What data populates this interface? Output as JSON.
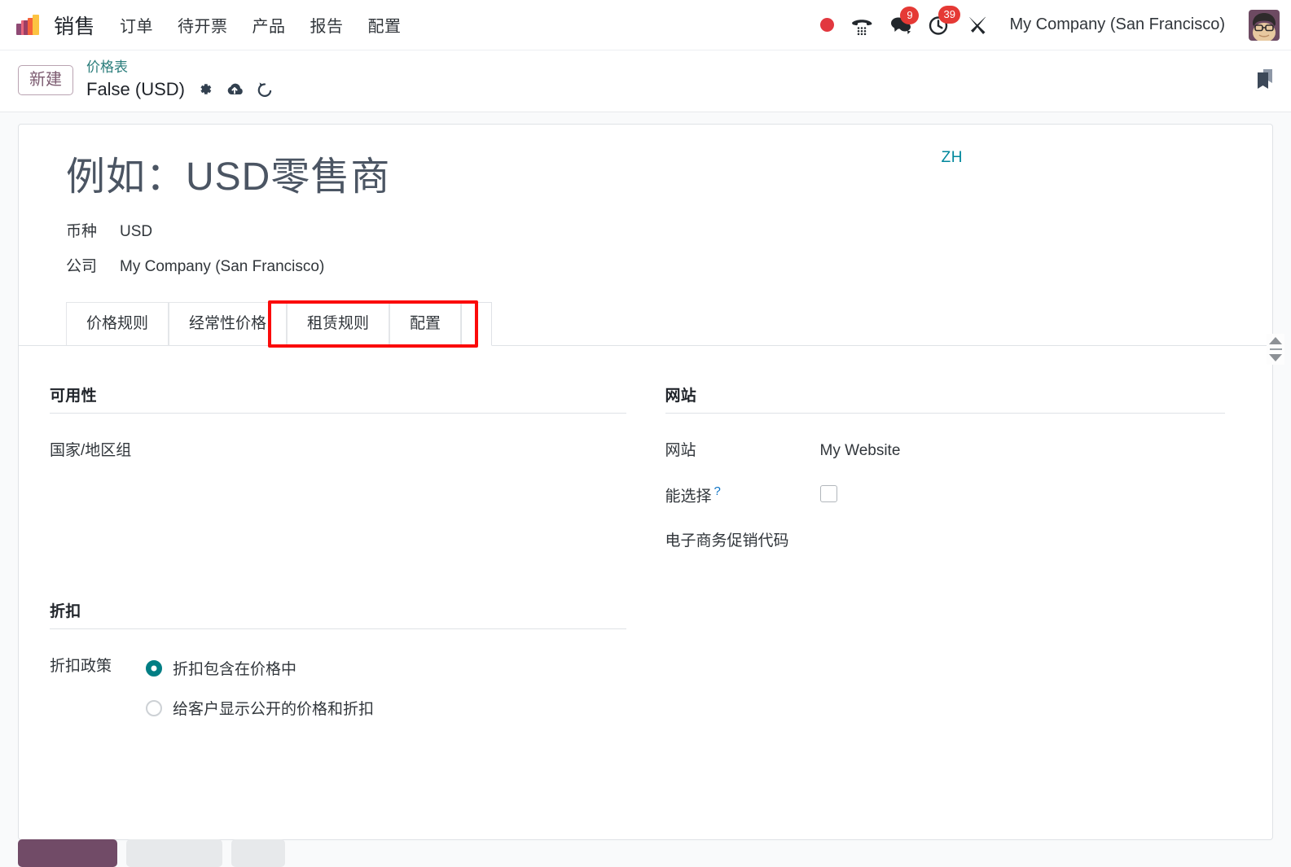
{
  "navbar": {
    "app_name": "销售",
    "menu_items": [
      {
        "label": "订单",
        "name": "nav-orders"
      },
      {
        "label": "待开票",
        "name": "nav-to-invoice"
      },
      {
        "label": "产品",
        "name": "nav-products"
      },
      {
        "label": "报告",
        "name": "nav-reporting"
      },
      {
        "label": "配置",
        "name": "nav-configuration"
      }
    ],
    "icons": {
      "record": "record-dot-icon",
      "phone": "phone-keypad-icon",
      "messages": "chat-bubbles-icon",
      "activities": "clock-activities-icon",
      "tools": "tools-wrench-icon"
    },
    "badges": {
      "messages": "9",
      "activities": "39"
    },
    "company": "My Company (San Francisco)",
    "avatar_alt": "user-avatar"
  },
  "control_panel": {
    "new_button": "新建",
    "breadcrumb_parent": "价格表",
    "breadcrumb_current": "False (USD)",
    "icons": {
      "settings": "gear-icon",
      "upload": "cloud-upload-icon",
      "discard": "undo-arrow-icon",
      "bookmark": "bookmark-icon"
    }
  },
  "form": {
    "title_placeholder": "例如：USD零售商",
    "lang_badge": "ZH",
    "fields": [
      {
        "label": "币种",
        "value": "USD",
        "name": "currency"
      },
      {
        "label": "公司",
        "value": "My Company (San Francisco)",
        "name": "company"
      }
    ]
  },
  "notebook": {
    "tabs": [
      {
        "label": "价格规则",
        "name": "tab-price-rules",
        "active": false
      },
      {
        "label": "经常性价格",
        "name": "tab-recurring-prices",
        "active": false
      },
      {
        "label": "租赁规则",
        "name": "tab-rental-rules",
        "active": false
      },
      {
        "label": "配置",
        "name": "tab-configuration",
        "active": false
      },
      {
        "label": "",
        "name": "tab-blank",
        "active": true
      }
    ],
    "highlight_color": "#fb0b0b",
    "highlighted_tabs": [
      "租赁规则",
      "配置"
    ]
  },
  "content": {
    "left": {
      "availability": {
        "title": "可用性",
        "rows": [
          {
            "label": "国家/地区组",
            "value": "",
            "name": "country-groups"
          }
        ]
      },
      "discount": {
        "title": "折扣",
        "policy_label": "折扣政策",
        "options": [
          {
            "label": "折扣包含在价格中",
            "checked": true,
            "name": "discount-included"
          },
          {
            "label": "给客户显示公开的价格和折扣",
            "checked": false,
            "name": "discount-shown"
          }
        ]
      }
    },
    "right": {
      "website": {
        "title": "网站",
        "rows": [
          {
            "label": "网站",
            "value": "My Website",
            "type": "text",
            "name": "website"
          },
          {
            "label": "能选择",
            "value": "",
            "type": "checkbox",
            "help": "?",
            "checked": false,
            "name": "selectable"
          },
          {
            "label": "电子商务促销代码",
            "value": "",
            "type": "text",
            "name": "ecommerce-promo-code"
          }
        ]
      }
    }
  },
  "colors": {
    "accent_purple": "#714b67",
    "teal": "#017e84",
    "link_teal": "#2a7d7b",
    "badge_red": "#e53935",
    "highlight_red": "#fb0b0b"
  }
}
